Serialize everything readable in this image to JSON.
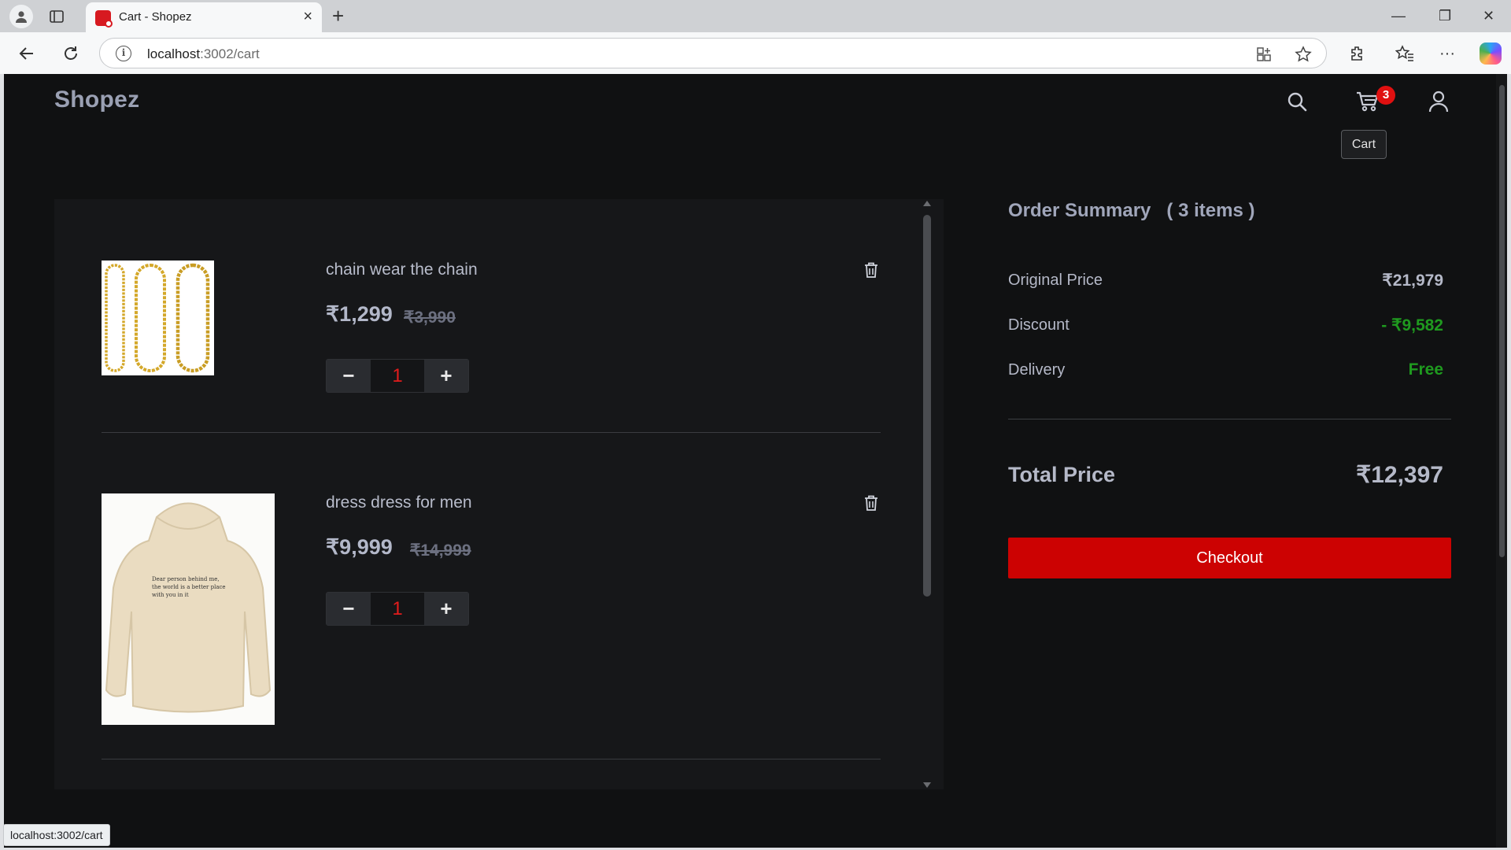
{
  "browser": {
    "tab_title": "Cart - Shopez",
    "url_host": "localhost",
    "url_rest": ":3002/cart",
    "status_url": "localhost:3002/cart"
  },
  "header": {
    "brand": "Shopez",
    "cart_count": "3",
    "cart_tooltip": "Cart"
  },
  "cart": {
    "items": [
      {
        "name": "chain wear the chain",
        "price": "₹1,299",
        "mrp": "₹3,990",
        "qty": "1",
        "minus": "−",
        "plus": "+"
      },
      {
        "name": "dress dress for men",
        "price": "₹9,999",
        "mrp": "₹14,999",
        "qty": "1",
        "minus": "−",
        "plus": "+",
        "print_lines": [
          "Dear person behind me,",
          "the world is a better place",
          "with you in it"
        ]
      }
    ]
  },
  "summary": {
    "title": "Order Summary",
    "count": "( 3 items )",
    "original_label": "Original Price",
    "original_value": "₹21,979",
    "discount_label": "Discount",
    "discount_value": "- ₹9,582",
    "delivery_label": "Delivery",
    "delivery_value": "Free",
    "total_label": "Total Price",
    "total_value": "₹12,397",
    "checkout_label": "Checkout"
  },
  "colors": {
    "accent_red": "#cc0202",
    "discount_green": "#1f9a1f",
    "qty_red": "#e31c1c"
  },
  "icons": [
    "search-icon",
    "cart-icon",
    "user-icon",
    "trash-icon",
    "back-icon",
    "reload-icon",
    "star-icon",
    "extensions-icon",
    "favorites-icon",
    "more-icon"
  ]
}
